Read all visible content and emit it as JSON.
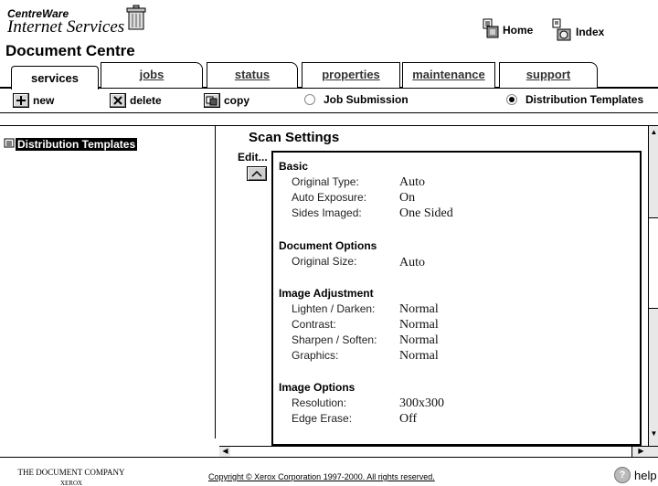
{
  "header": {
    "brand_top": "CentreWare",
    "brand_main": "Internet Services",
    "page_title": "Document Centre",
    "home_label": "Home",
    "index_label": "Index"
  },
  "tabs": [
    {
      "label": "services",
      "active": true
    },
    {
      "label": "jobs",
      "active": false
    },
    {
      "label": "status",
      "active": false
    },
    {
      "label": "properties",
      "active": false
    },
    {
      "label": "maintenance",
      "active": false
    },
    {
      "label": "support",
      "active": false
    }
  ],
  "toolbar": {
    "new_label": "new",
    "delete_label": "delete",
    "copy_label": "copy",
    "job_submission_label": "Job Submission",
    "distribution_templates_label": "Distribution Templates",
    "selected_view": "Distribution Templates"
  },
  "tree": {
    "selected_item": "Distribution Templates"
  },
  "scan": {
    "title": "Scan Settings",
    "edit_label": "Edit...",
    "groups": [
      {
        "heading": "Basic",
        "rows": [
          {
            "label": "Original Type:",
            "value": "Auto"
          },
          {
            "label": "Auto Exposure:",
            "value": "On"
          },
          {
            "label": "Sides Imaged:",
            "value": "One Sided"
          }
        ]
      },
      {
        "heading": "Document Options",
        "rows": [
          {
            "label": "Original Size:",
            "value": "Auto"
          }
        ]
      },
      {
        "heading": "Image Adjustment",
        "rows": [
          {
            "label": "Lighten / Darken:",
            "value": "Normal"
          },
          {
            "label": "Contrast:",
            "value": "Normal"
          },
          {
            "label": "Sharpen / Soften:",
            "value": "Normal"
          },
          {
            "label": "Graphics:",
            "value": "Normal"
          }
        ]
      },
      {
        "heading": "Image Options",
        "rows": [
          {
            "label": "Resolution:",
            "value": "300x300"
          },
          {
            "label": "Edge Erase:",
            "value": "Off"
          }
        ]
      }
    ]
  },
  "footer": {
    "company_line1": "THE DOCUMENT COMPANY",
    "company_line2": "XEROX",
    "copyright": "Copyright © Xerox Corporation 1997-2000. All rights reserved.",
    "help_label": "help"
  }
}
